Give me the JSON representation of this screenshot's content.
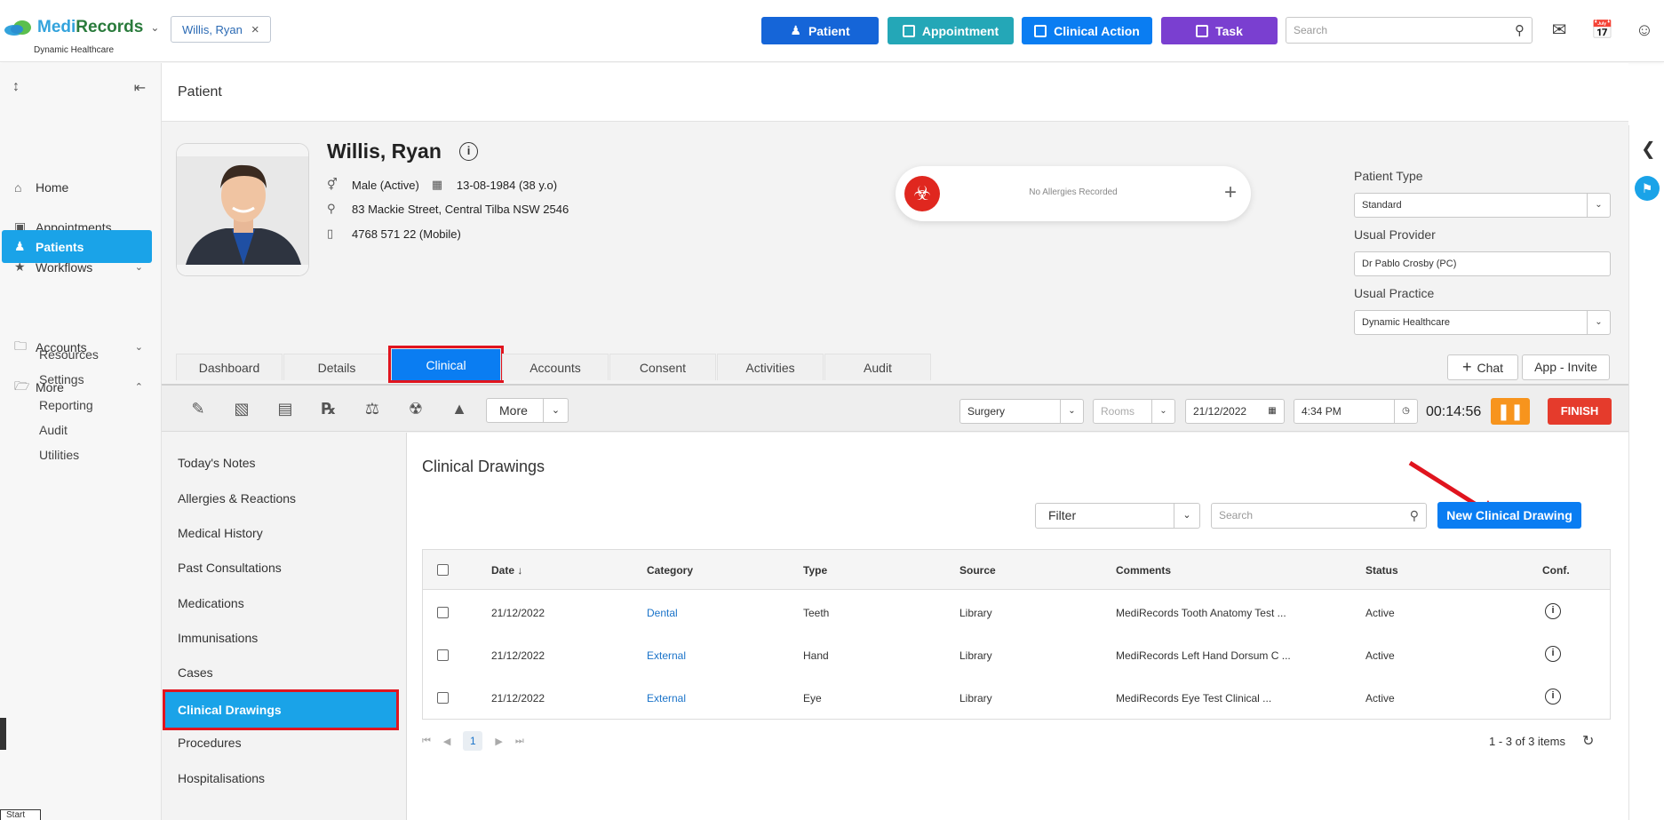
{
  "app": {
    "brand_medi": "Medi",
    "brand_records": "Records",
    "brand_sub": "Dynamic Healthcare",
    "patient_chip": "Willis, Ryan"
  },
  "topbar": {
    "buttons": [
      {
        "label": "Patient",
        "color": "#1565d8"
      },
      {
        "label": "Appointment",
        "color": "#24a7b7"
      },
      {
        "label": "Clinical Action",
        "color": "#0a7df2"
      },
      {
        "label": "Task",
        "color": "#7a3fd0"
      }
    ],
    "search_placeholder": "Search"
  },
  "sidebar": {
    "items": [
      {
        "label": "Home"
      },
      {
        "label": "Appointments"
      },
      {
        "label": "Workflows"
      },
      {
        "label": "Patients"
      },
      {
        "label": "Accounts"
      },
      {
        "label": "More"
      }
    ],
    "sub_items": [
      "Resources",
      "Settings",
      "Reporting",
      "Audit",
      "Utilities"
    ]
  },
  "page": {
    "title": "Patient"
  },
  "patient": {
    "name": "Willis, Ryan",
    "gender": "Male (Active)",
    "dob": "13-08-1984 (38 y.o)",
    "address": "83 Mackie Street, Central Tilba NSW 2546",
    "phone": "4768 571 22 (Mobile)",
    "allergy_text": "No Allergies Recorded"
  },
  "right_fields": {
    "patient_type_label": "Patient Type",
    "patient_type_value": "Standard",
    "usual_provider_label": "Usual Provider",
    "usual_provider_value": "Dr Pablo Crosby (PC)",
    "usual_practice_label": "Usual Practice",
    "usual_practice_value": "Dynamic Healthcare"
  },
  "tabs": [
    "Dashboard",
    "Details",
    "Clinical",
    "Accounts",
    "Consent",
    "Activities",
    "Audit"
  ],
  "actions": {
    "chat": "Chat",
    "app_invite": "App - Invite"
  },
  "toolbar": {
    "more": "More",
    "location": "Surgery",
    "rooms_placeholder": "Rooms",
    "date": "21/12/2022",
    "time": "4:34 PM",
    "timer": "00:14:56",
    "finish": "FINISH"
  },
  "clinical_nav": [
    "Today's Notes",
    "Allergies & Reactions",
    "Medical History",
    "Past Consultations",
    "Medications",
    "Immunisations",
    "Cases",
    "Clinical Drawings",
    "Procedures",
    "Hospitalisations"
  ],
  "drawings": {
    "title": "Clinical Drawings",
    "filter": "Filter",
    "search_placeholder": "Search",
    "new_button": "New Clinical Drawing",
    "columns": [
      "Date",
      "Category",
      "Type",
      "Source",
      "Comments",
      "Status",
      "Conf."
    ],
    "rows": [
      {
        "date": "21/12/2022",
        "category": "Dental",
        "type": "Teeth",
        "source": "Library",
        "comments": "MediRecords Tooth Anatomy Test ...",
        "status": "Active"
      },
      {
        "date": "21/12/2022",
        "category": "External",
        "type": "Hand",
        "source": "Library",
        "comments": "MediRecords Left Hand Dorsum C ...",
        "status": "Active"
      },
      {
        "date": "21/12/2022",
        "category": "External",
        "type": "Eye",
        "source": "Library",
        "comments": "MediRecords Eye Test Clinical ...",
        "status": "Active"
      }
    ],
    "page": "1",
    "page_info": "1 - 3 of 3 items"
  },
  "misc": {
    "start": "Start"
  }
}
